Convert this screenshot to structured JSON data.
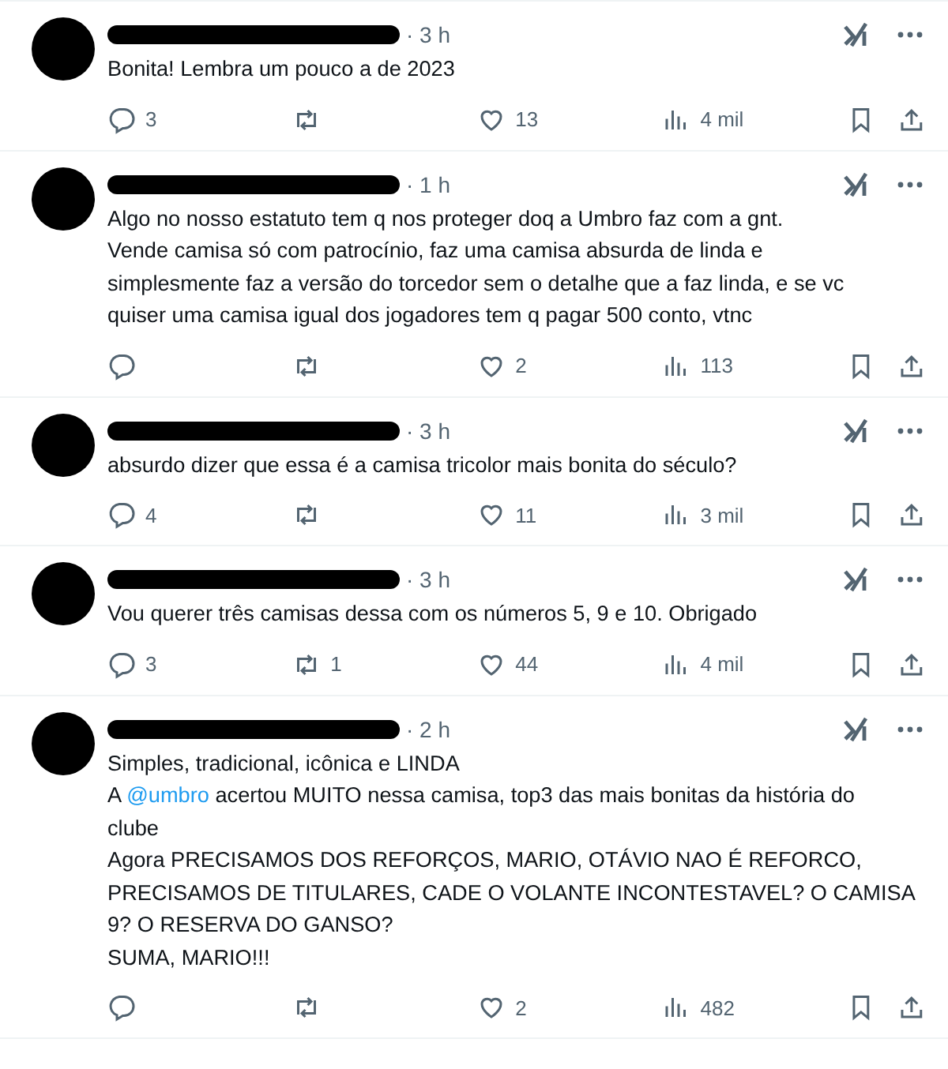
{
  "replies": [
    {
      "time": "· 3 h",
      "body": [
        {
          "text": "Bonita! Lembra um pouco a de 2023"
        }
      ],
      "stats": {
        "replies": "3",
        "likes": "13",
        "views": "4 mil"
      }
    },
    {
      "time": "· 1 h",
      "body": [
        {
          "text": "Algo no nosso estatuto tem q nos proteger doq a Umbro faz com a gnt.\nVende camisa só com patrocínio, faz uma camisa absurda de linda e\nsimplesmente faz a versão do torcedor sem o detalhe que a faz linda, e se vc\nquiser uma camisa igual dos jogadores tem q pagar 500 conto, vtnc"
        }
      ],
      "stats": {
        "likes": "2",
        "views": "113"
      }
    },
    {
      "time": "· 3 h",
      "body": [
        {
          "text": "absurdo dizer que essa é a camisa tricolor mais bonita do século?"
        }
      ],
      "stats": {
        "replies": "4",
        "likes": "11",
        "views": "3 mil"
      }
    },
    {
      "time": "· 3 h",
      "body": [
        {
          "text": "Vou querer três camisas dessa com os números 5, 9 e 10. Obrigado"
        }
      ],
      "stats": {
        "replies": "3",
        "reposts": "1",
        "likes": "44",
        "views": "4 mil"
      }
    },
    {
      "time": "· 2 h",
      "body": [
        {
          "text": "Simples, tradicional, icônica e LINDA\nA "
        },
        {
          "text": "@umbro",
          "kind": "mention"
        },
        {
          "text": " acertou MUITO nessa camisa, top3 das mais bonitas da história do\nclube\nAgora PRECISAMOS DOS REFORÇOS, MARIO, OTÁVIO NAO É REFORCO,\nPRECISAMOS DE TITULARES, CADE O VOLANTE INCONTESTAVEL? O CAMISA\n9? O RESERVA DO GANSO?\nSUMA, MARIO!!!"
        }
      ],
      "stats": {
        "likes": "2",
        "views": "482"
      }
    }
  ]
}
